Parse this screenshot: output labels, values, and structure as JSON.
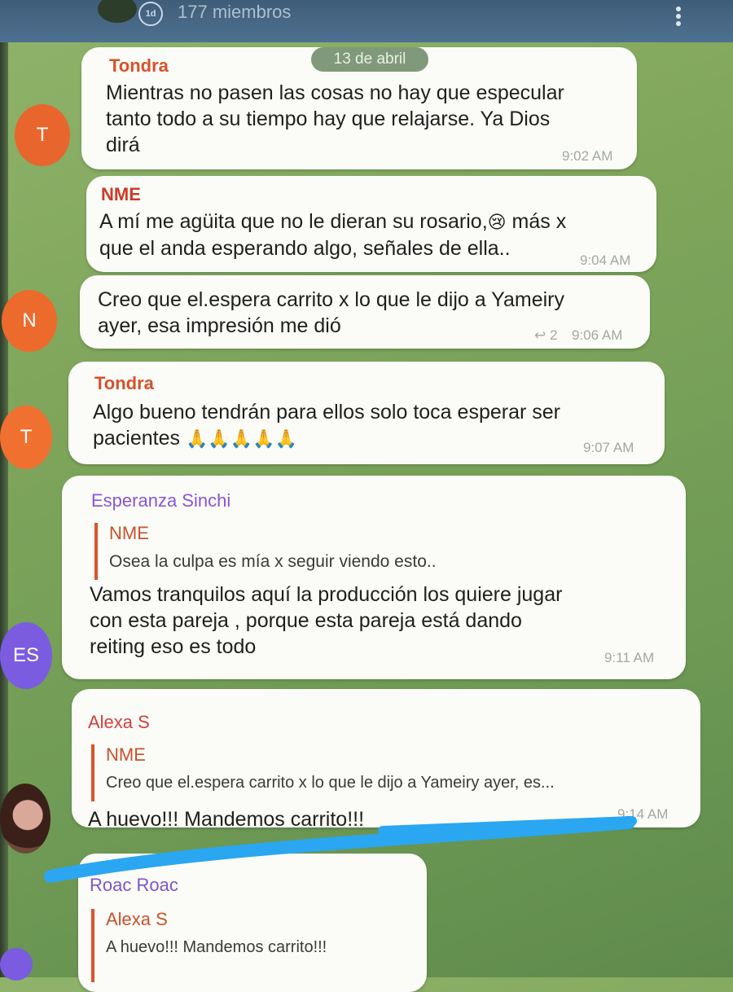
{
  "header": {
    "avatar_badge": "1d",
    "members": "177 miembros"
  },
  "date_separator": "13 de abril",
  "messages": [
    {
      "sender": "Tondra",
      "text": "Mientras no pasen las cosas no hay que especular\ntanto todo a su tiempo hay que relajarse. Ya Dios\ndirá",
      "time": "9:02 AM",
      "avatar": "T"
    },
    {
      "sender": "NME",
      "text_a": "A mí me agüita que no le dieran su rosario,",
      "emoji": "😢",
      "text_b": " más x\nque el anda esperando algo, señales de ella..",
      "time": "9:04 AM"
    },
    {
      "text": "Creo que el.espera carrito x lo que le dijo a Yameiry\nayer, esa impresión me dió",
      "replies": "↩ 2",
      "time": "9:06 AM",
      "avatar": "N"
    },
    {
      "sender": "Tondra",
      "text_a": "Algo bueno tendrán para ellos solo toca esperar ser\npacientes ",
      "emoji": "🙏🙏🙏🙏🙏",
      "time": "9:07 AM",
      "avatar": "T"
    },
    {
      "sender": "Esperanza Sinchi",
      "reply_name": "NME",
      "reply_text": "Osea la culpa es mía x seguir viendo esto..",
      "text": "Vamos tranquilos aquí la producción los quiere jugar\ncon esta pareja , porque esta pareja está dando\nreiting eso es todo",
      "time": "9:11 AM",
      "avatar": "ES"
    },
    {
      "sender": "Alexa S",
      "reply_name": "NME",
      "reply_text": "Creo que el.espera carrito x lo que le dijo a Yameiry ayer, es...",
      "text": "A huevo!!! Mandemos carrito!!!",
      "time": "9:14 AM"
    },
    {
      "sender": "Roac Roac",
      "reply_name": "Alexa S",
      "reply_text": "A huevo!!! Mandemos carrito!!!"
    }
  ],
  "colors": {
    "tondra": "#d6502a",
    "nme": "#cc3a2a",
    "esperanza": "#8a55d6",
    "alexa": "#cf4040",
    "roac": "#7b55d0",
    "avatar_orange": "#ea6a2e",
    "avatar_purple": "#7b5cd6",
    "highlight": "#2aa7f0"
  }
}
